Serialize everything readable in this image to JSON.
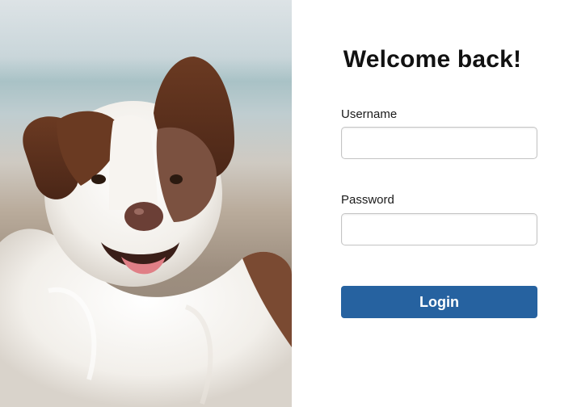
{
  "photo": {
    "subject": "dog-photo"
  },
  "login_form": {
    "title": "Welcome back!",
    "username_label": "Username",
    "username_value": "",
    "password_label": "Password",
    "password_value": "",
    "login_label": "Login"
  },
  "colors": {
    "accent": "#2662a0",
    "input_border": "#c4c4c4",
    "title_text": "#111111"
  }
}
